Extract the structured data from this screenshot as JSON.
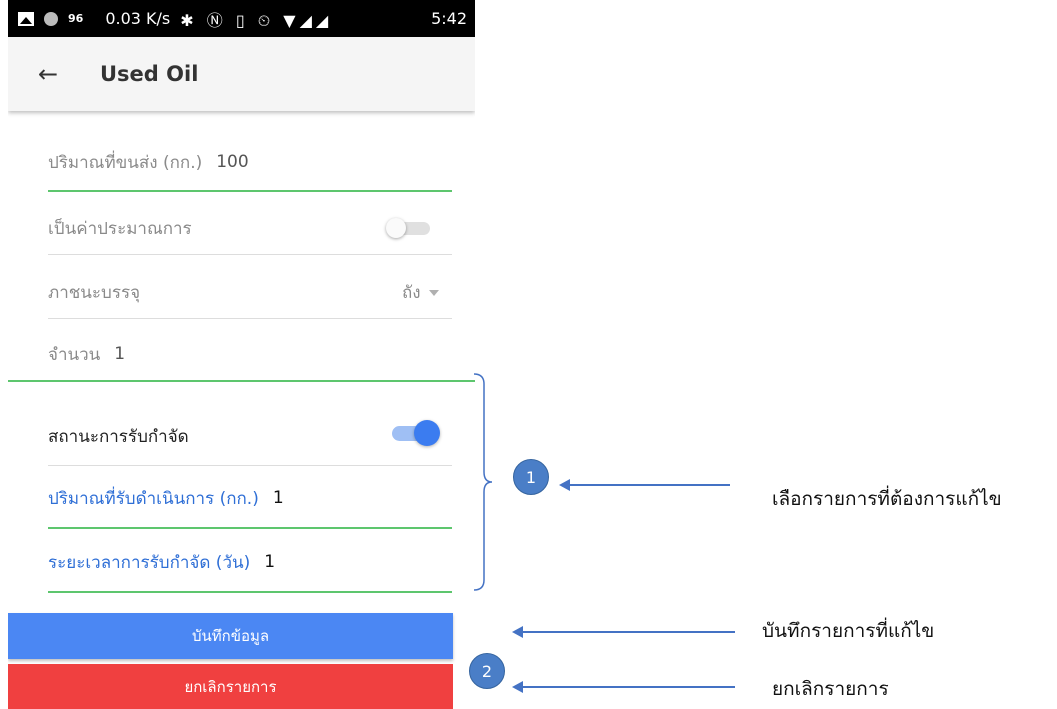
{
  "statusbar": {
    "battery_level": "96",
    "speed": "0.03 K/s",
    "icons": "✱ Ⓝ ▯ ⏲ ▼◢◢",
    "time": "5:42"
  },
  "appbar": {
    "back_icon": "←",
    "title": "Used Oil"
  },
  "form": {
    "transport_qty_label": "ปริมาณที่ขนส่ง (กก.)",
    "transport_qty_value": "100",
    "estimate_label": "เป็นค่าประมาณการ",
    "estimate_on": false,
    "container_label": "ภาชนะบรรจุ",
    "container_value": "ถัง",
    "count_label": "จำนวน",
    "count_value": "1",
    "disposal_status_label": "สถานะการรับกำจัด",
    "disposal_status_on": true,
    "received_qty_label": "ปริมาณที่รับดำเนินการ (กก.)",
    "received_qty_value": "1",
    "disposal_duration_label": "ระยะเวลาการรับกำจัด (วัน)",
    "disposal_duration_value": "1"
  },
  "buttons": {
    "save": "บันทึกข้อมูล",
    "cancel": "ยกเลิกรายการ"
  },
  "annotations": {
    "marker1": "1",
    "marker2": "2",
    "note1": "เลือกรายการที่ต้องการแก้ไข",
    "note_save": "บันทึกรายการที่แก้ไข",
    "note_cancel": "ยกเลิกรายการ"
  },
  "colors": {
    "accent_green": "#5dc66e",
    "save_blue": "#4b87f3",
    "cancel_red": "#f04040",
    "annotation_blue": "#4472c4"
  }
}
